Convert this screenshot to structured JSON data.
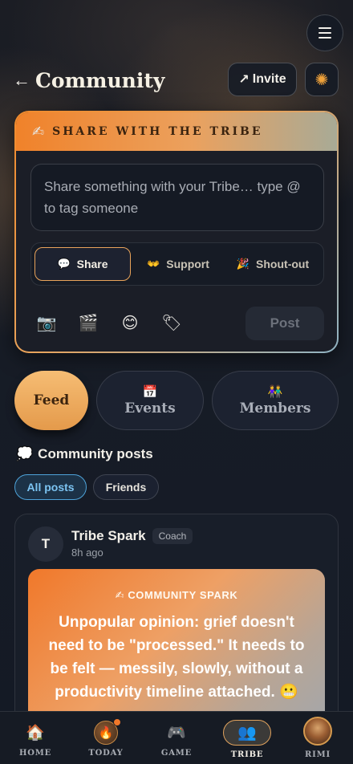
{
  "header": {
    "back_icon": "←",
    "title": "Community",
    "invite_icon": "↗",
    "invite_label": "Invite",
    "sun_icon": "✺"
  },
  "share_card": {
    "heading_icon": "✍",
    "heading": "SHARE WITH THE TRIBE",
    "placeholder": "Share something with your Tribe… type @ to tag someone",
    "modes": [
      {
        "icon": "💬",
        "label": "Share",
        "active": true
      },
      {
        "icon": "👐",
        "label": "Support",
        "active": false
      },
      {
        "icon": "🎉",
        "label": "Shout-out",
        "active": false
      }
    ],
    "tools": [
      {
        "name": "camera",
        "glyph": "📷"
      },
      {
        "name": "clapperboard",
        "glyph": "🎬"
      },
      {
        "name": "smile",
        "glyph": "😊"
      },
      {
        "name": "tag",
        "glyph": "🏷"
      }
    ],
    "post_label": "Post"
  },
  "tabs": [
    {
      "label": "Feed",
      "icon": "",
      "active": true
    },
    {
      "label": "Events",
      "icon": "📅",
      "active": false
    },
    {
      "label": "Members",
      "icon": "👫",
      "active": false
    }
  ],
  "posts_section": {
    "icon": "💭",
    "title": "Community posts",
    "filters": [
      {
        "label": "All posts",
        "active": true
      },
      {
        "label": "Friends",
        "active": false
      }
    ]
  },
  "post": {
    "avatar_initial": "T",
    "author": "Tribe Spark",
    "role": "Coach",
    "time": "8h ago",
    "spark_icon": "✍",
    "spark_label": "COMMUNITY SPARK",
    "text": "Unpopular opinion: grief doesn't need to be \"processed.\" It needs to be felt — messily, slowly, without a productivity timeline attached. 😬"
  },
  "nav": [
    {
      "label": "HOME",
      "icon": "🏠",
      "active": false
    },
    {
      "label": "TODAY",
      "icon": "🔥",
      "active": false,
      "badge": true
    },
    {
      "label": "GAME",
      "icon": "🎮",
      "active": false
    },
    {
      "label": "TRIBE",
      "icon": "👥",
      "active": true
    },
    {
      "label": "RIMI",
      "icon": "avatar",
      "active": false
    }
  ],
  "colors": {
    "accent_orange": "#f0822a",
    "accent_blue": "#4ea3d9",
    "background": "#141a25"
  }
}
